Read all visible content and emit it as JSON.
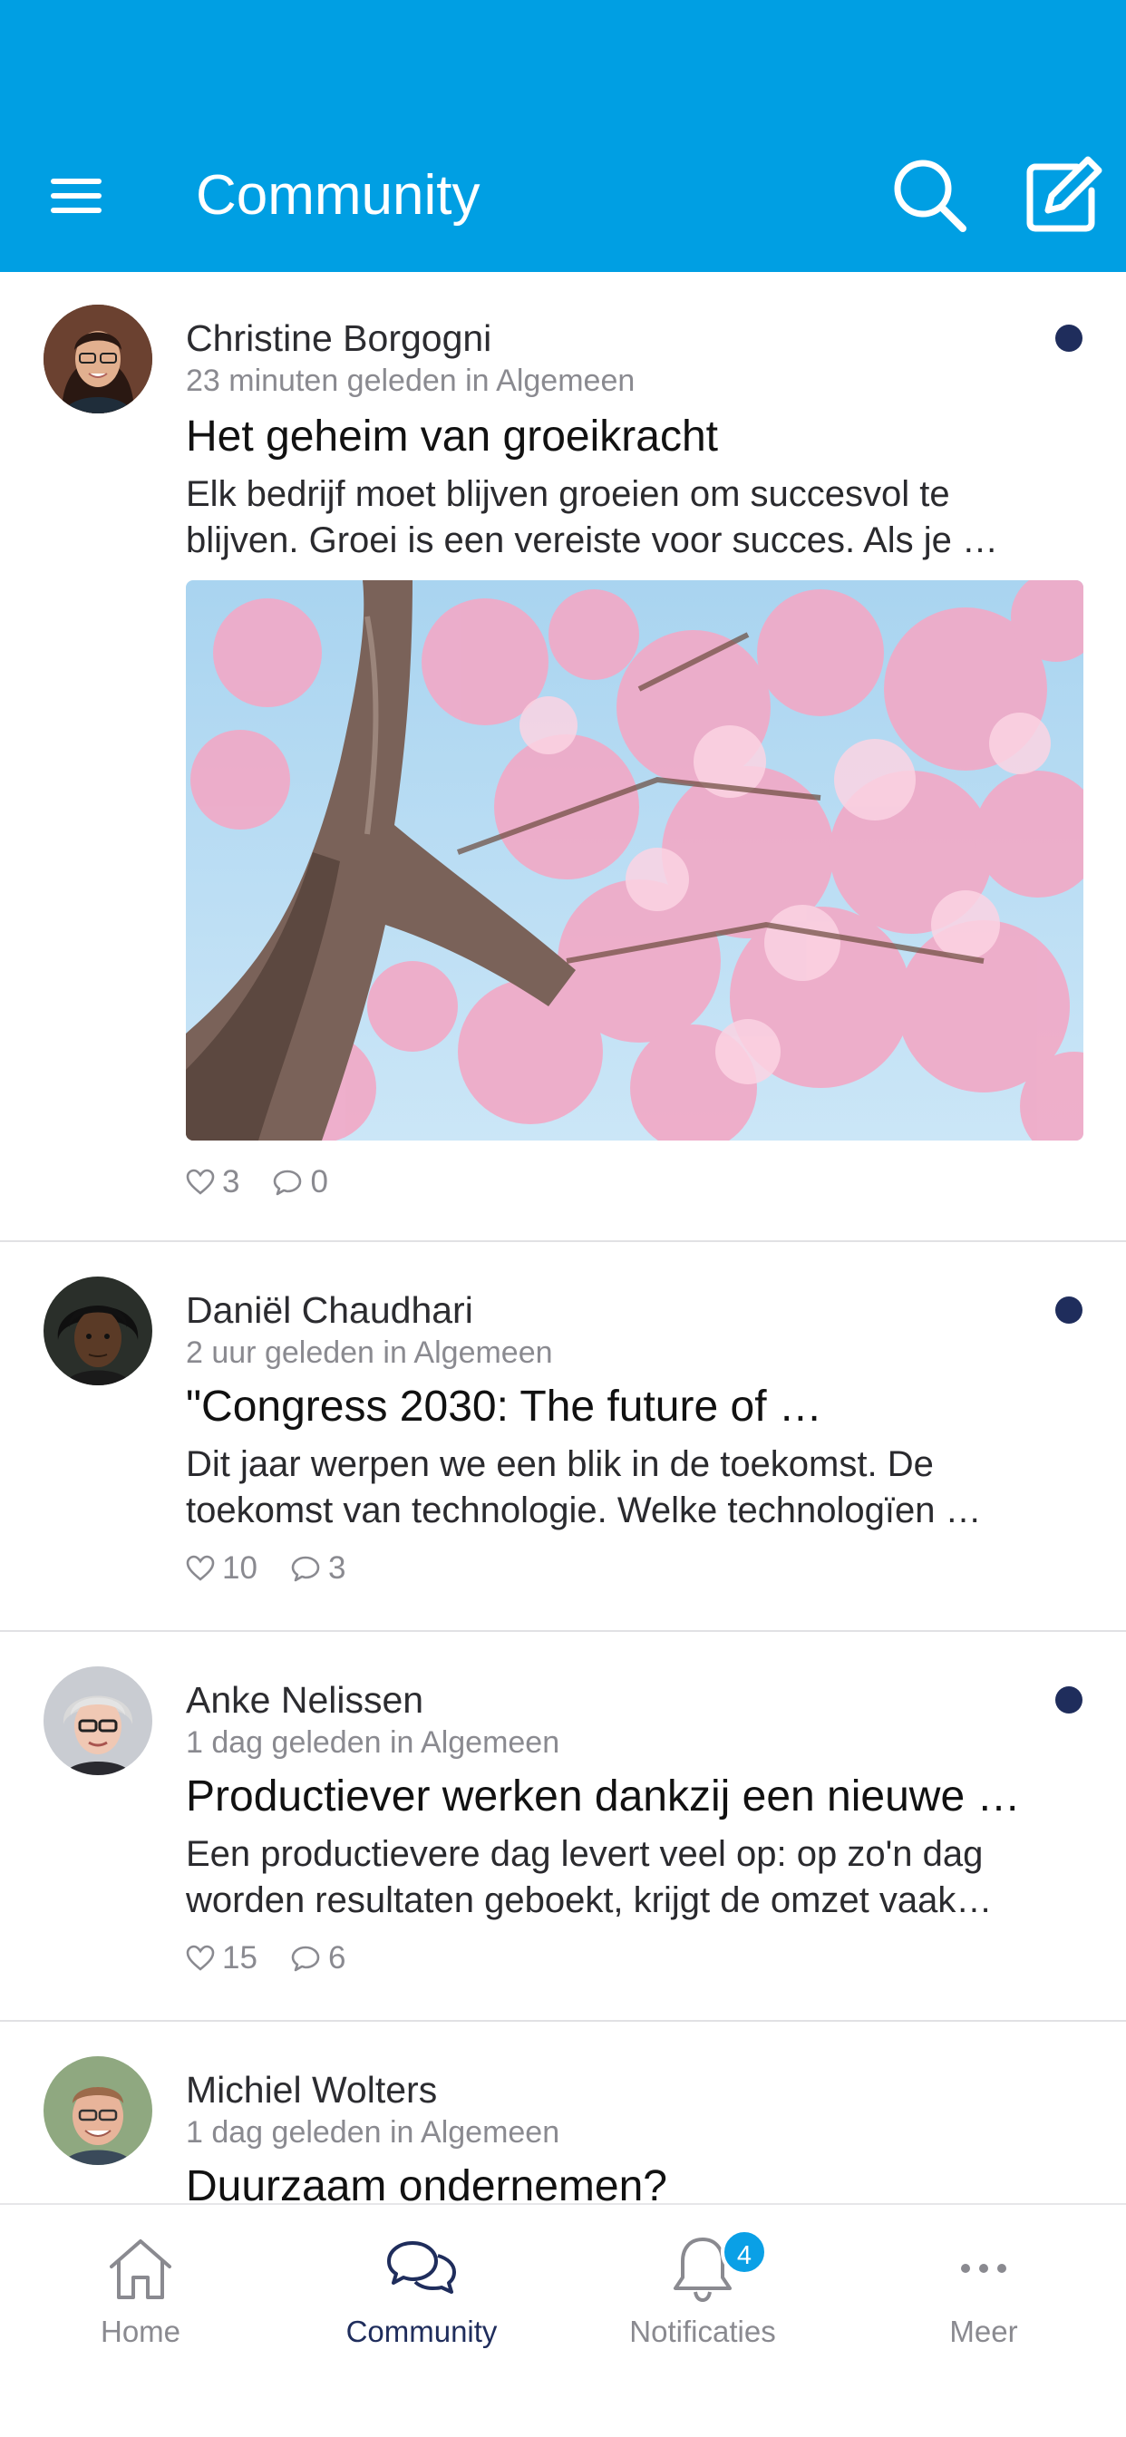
{
  "header": {
    "title": "Community",
    "background_color": "#009fe3",
    "icons": [
      "menu-icon",
      "search-icon",
      "compose-icon"
    ]
  },
  "posts": [
    {
      "author": "Christine Borgogni",
      "meta": "23 minuten geleden in Algemeen",
      "title": "Het geheim van groeikracht",
      "excerpt_lines": [
        "Elk bedrijf moet blijven groeien om succesvol te",
        "blijven. Groei is een vereiste voor succes. Als je …"
      ],
      "has_image": true,
      "likes": "3",
      "comments": "0",
      "unread": true
    },
    {
      "author": "Daniël Chaudhari",
      "meta": "2 uur geleden in Algemeen",
      "title": "\"Congress 2030: The future of …",
      "excerpt_lines": [
        "Dit jaar werpen we een blik in de toekomst. De",
        "toekomst van technologie. Welke technologïen …"
      ],
      "has_image": false,
      "likes": "10",
      "comments": "3",
      "unread": true
    },
    {
      "author": "Anke Nelissen",
      "meta": "1 dag geleden in Algemeen",
      "title": "Productiever werken dankzij een nieuwe …",
      "excerpt_lines": [
        "Een productievere dag levert veel op: op zo'n dag",
        "worden resultaten geboekt, krijgt de omzet vaak…"
      ],
      "has_image": false,
      "likes": "15",
      "comments": "6",
      "unread": true
    },
    {
      "author": "Michiel Wolters",
      "meta": "1 dag geleden in Algemeen",
      "title": "Duurzaam ondernemen?",
      "unread": false
    }
  ],
  "tabbar": {
    "tabs": [
      {
        "label": "Home",
        "icon": "home-icon",
        "active": false
      },
      {
        "label": "Community",
        "icon": "chat-bubbles-icon",
        "active": true
      },
      {
        "label": "Notificaties",
        "icon": "bell-icon",
        "active": false,
        "badge": "4"
      },
      {
        "label": "Meer",
        "icon": "more-dots-icon",
        "active": false
      }
    ]
  },
  "colors": {
    "accent": "#009fe3",
    "active_tab": "#1f2d5c",
    "unread_dot": "#1f2d5c",
    "badge": "#0aa0e6"
  }
}
